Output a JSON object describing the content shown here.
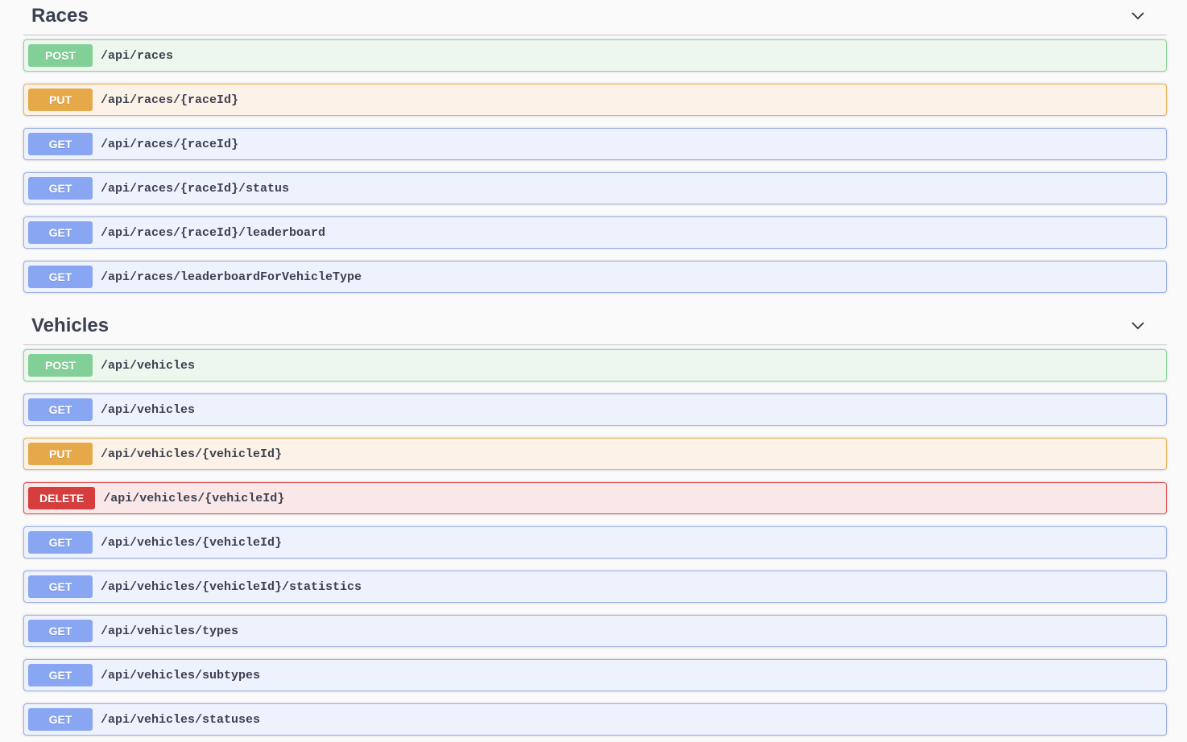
{
  "sections": [
    {
      "title": "Races",
      "operations": [
        {
          "method": "POST",
          "path": "/api/races"
        },
        {
          "method": "PUT",
          "path": "/api/races/{raceId}"
        },
        {
          "method": "GET",
          "path": "/api/races/{raceId}"
        },
        {
          "method": "GET",
          "path": "/api/races/{raceId}/status"
        },
        {
          "method": "GET",
          "path": "/api/races/{raceId}/leaderboard"
        },
        {
          "method": "GET",
          "path": "/api/races/leaderboardForVehicleType"
        }
      ]
    },
    {
      "title": "Vehicles",
      "operations": [
        {
          "method": "POST",
          "path": "/api/vehicles"
        },
        {
          "method": "GET",
          "path": "/api/vehicles"
        },
        {
          "method": "PUT",
          "path": "/api/vehicles/{vehicleId}"
        },
        {
          "method": "DELETE",
          "path": "/api/vehicles/{vehicleId}"
        },
        {
          "method": "GET",
          "path": "/api/vehicles/{vehicleId}"
        },
        {
          "method": "GET",
          "path": "/api/vehicles/{vehicleId}/statistics"
        },
        {
          "method": "GET",
          "path": "/api/vehicles/types"
        },
        {
          "method": "GET",
          "path": "/api/vehicles/subtypes"
        },
        {
          "method": "GET",
          "path": "/api/vehicles/statuses"
        }
      ]
    }
  ],
  "icons": {
    "collapse": "chevron-down-icon"
  },
  "colors": {
    "post": "#49cc90",
    "put": "#fca130",
    "get": "#61afe",
    "delete": "#f93e3e"
  }
}
